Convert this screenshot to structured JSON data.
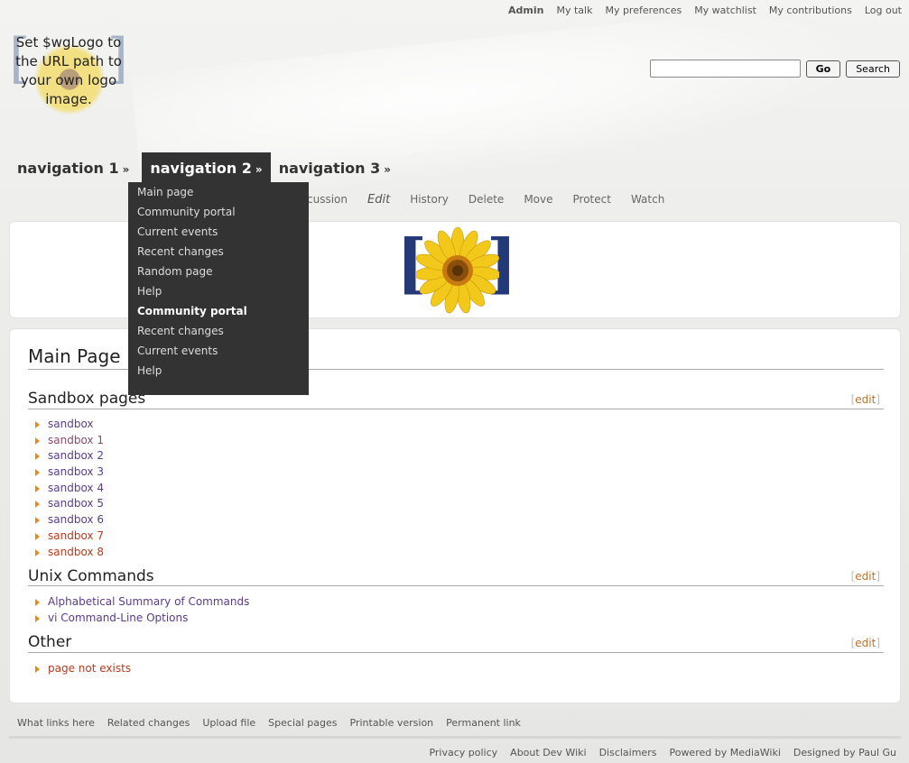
{
  "personal": {
    "user": "Admin",
    "talk": "My talk",
    "preferences": "My preferences",
    "watchlist": "My watchlist",
    "contributions": "My contributions",
    "logout": "Log out"
  },
  "logo": {
    "text": "Set $wgLogo to the URL path to your own logo image."
  },
  "search": {
    "value": "",
    "go": "Go",
    "search": "Search"
  },
  "nav": {
    "items": [
      {
        "label": "navigation 1",
        "arrow": "»"
      },
      {
        "label": "navigation 2",
        "arrow": "»"
      },
      {
        "label": "navigation 3",
        "arrow": "»"
      }
    ],
    "dropdown": [
      "Main page",
      "Community portal",
      "Current events",
      "Recent changes",
      "Random page",
      "Help",
      "Community portal",
      "Recent changes",
      "Current events",
      "Help"
    ]
  },
  "actions": {
    "discussion": "cussion",
    "edit": "Edit",
    "history": "History",
    "delete": "Delete",
    "move": "Move",
    "protect": "Protect",
    "watch": "Watch"
  },
  "content": {
    "title": "Main Page",
    "edit_label": "edit",
    "sections": [
      {
        "heading": "Sandbox pages",
        "items": [
          "sandbox",
          "sandbox 1",
          "sandbox 2",
          "sandbox 3",
          "sandbox 4",
          "sandbox 5",
          "sandbox 6",
          "sandbox 7",
          "sandbox 8"
        ]
      },
      {
        "heading": "Unix Commands",
        "items": [
          "Alphabetical Summary of Commands",
          "vi Command-Line Options"
        ]
      },
      {
        "heading": "Other",
        "items": [
          "page not exists"
        ]
      }
    ]
  },
  "toolbox": [
    "What links here",
    "Related changes",
    "Upload file",
    "Special pages",
    "Printable version",
    "Permanent link"
  ],
  "footer": [
    "Privacy policy",
    "About Dev Wiki",
    "Disclaimers",
    "Powered by MediaWiki",
    "Designed by Paul Gu"
  ],
  "colors": {
    "link_existing": "#5a3c8a",
    "link_missing": "#b83a1e",
    "nav_active_bg": "#333333",
    "bullet": "#e8891a",
    "edit_link": "#c0722c"
  }
}
